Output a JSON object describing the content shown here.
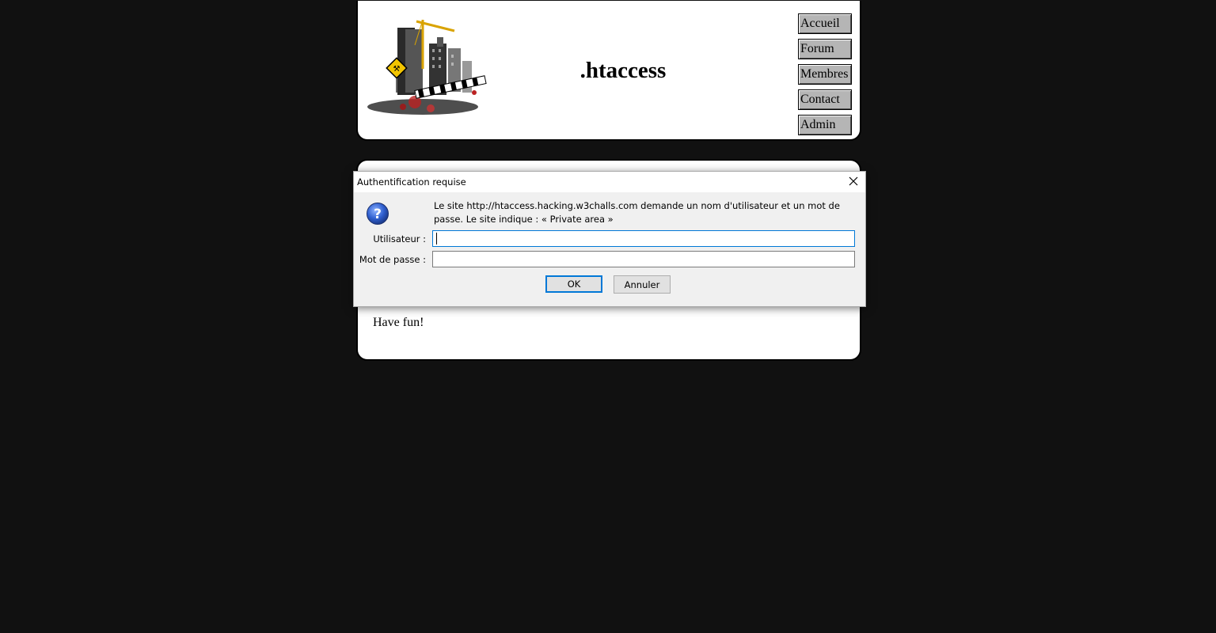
{
  "site": {
    "title": ".htaccess",
    "nav": [
      {
        "label": "Accueil"
      },
      {
        "label": "Forum"
      },
      {
        "label": "Membres"
      },
      {
        "label": "Contact"
      },
      {
        "label": "Admin"
      }
    ],
    "content_text": "Have fun!",
    "logo_icon": "city-construction-logo-icon"
  },
  "dialog": {
    "title": "Authentification requise",
    "message": "Le site http://htaccess.hacking.w3challs.com demande un nom d'utilisateur et un mot de passe. Le site indique : « Private area »",
    "username_label": "Utilisateur :",
    "password_label": "Mot de passe :",
    "username_value": "",
    "password_value": "",
    "ok_label": "OK",
    "cancel_label": "Annuler",
    "icon": "question-icon",
    "accent_color": "#0078d7"
  },
  "colors": {
    "background": "#111111",
    "panel": "#ffffff",
    "nav_button": "#b5b5b5",
    "dialog_bg": "#f0f0f0"
  }
}
